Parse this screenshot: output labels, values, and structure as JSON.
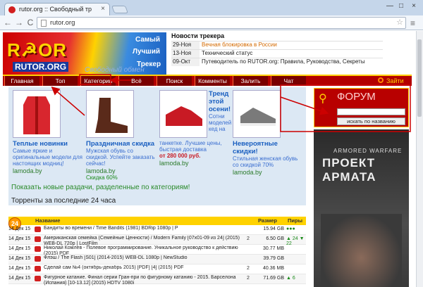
{
  "browser": {
    "tab_title": "rutor.org :: Свободный тр",
    "tab_close": "×",
    "url": "rutor.org",
    "back": "←",
    "forward": "→",
    "reload": "C",
    "star": "☆",
    "menu": "≡",
    "minimize": "—",
    "maximize": "□",
    "close": "×"
  },
  "header": {
    "logo": "R☭OR",
    "logo_domain": "RUTOR.ORG",
    "slogan": [
      "Самый",
      "Лучший",
      "Трекер"
    ],
    "subtitle": "Свободный обмен"
  },
  "news": {
    "title": "Новости трекера",
    "items": [
      {
        "date": "29-Ноя",
        "text": "Вечная блокировка в России",
        "hot": true
      },
      {
        "date": "13-Ноя",
        "text": "Технический статус",
        "hot": false
      },
      {
        "date": "09-Окт",
        "text": "Путеводитель по RUTOR.org: Правила, Руководства, Секреты",
        "hot": false
      }
    ]
  },
  "menu": {
    "items": [
      "Главная",
      "Топ",
      "Категории",
      "Всё",
      "Поиск",
      "Комменты",
      "Залить",
      "Чат"
    ],
    "login": "Зайти"
  },
  "ads": [
    {
      "title": "Теплые новинки",
      "desc": "Самые яркие и оригинальные модели для настоящих модниц!",
      "site": "lamoda.by",
      "price": ""
    },
    {
      "title": "Праздничная скидка",
      "desc": "Мужская обувь со скидкой. Успейте заказать сейчас!",
      "site": "lamoda.by",
      "price": "Скидка 60%"
    },
    {
      "title": "",
      "desc": "танкетке. Лучшие цены, быстрая доставка",
      "site": "lamoda.by",
      "price": "от 280 000 руб.",
      "side_title": "Тренд этой осени!",
      "side_desc": "Сотни моделей кед на"
    },
    {
      "title": "Невероятные скидки!",
      "desc": "Стильная женская обувь со скидкой 70%",
      "site": "lamoda.by",
      "price": ""
    }
  ],
  "categories_link": "Показать новые раздачи, разделенные по категориям!",
  "last24": "Торренты за последние 24 часа",
  "forum": {
    "label": "ФОРУМ",
    "button": "искать по названию"
  },
  "banner": {
    "line1": "ARMORED WARFARE",
    "line2": "ПРОЕКТ АРМАТА"
  },
  "table": {
    "badge": "24",
    "columns": [
      "Название",
      "Размер",
      "Пиры"
    ],
    "rows": [
      {
        "date": "14 Дек 15",
        "name": "Бандиты во времени / Time Bandits (1981) BDRip 1080p | P",
        "size": "15.94 GB",
        "peers": "●●●"
      },
      {
        "date": "14 Дек 15",
        "name": "Американская семейка (Семейные Ценности) / Modern Family [07x01-09 из 24] (2015) WEB-DL 720p | LostFilm",
        "size": "6.50 GB",
        "peers": "▲ 24 ▼ 22",
        "link": "2"
      },
      {
        "date": "14 Дек 15",
        "name": "Николай Комлев - Полевое программирование. Уникальное руководство к действию (2015) PDF",
        "size": "30.77 MB",
        "peers": ""
      },
      {
        "date": "14 Дек 15",
        "name": "Флэш / The Flash [S01] (2014-2015) WEB-DL 1080p | NewStudio",
        "size": "39.79 GB",
        "peers": ""
      },
      {
        "date": "14 Дек 15",
        "name": "Сделай сам №4 (октябрь-декабрь 2015) [PDF] [4] (2015) PDF",
        "size": "40.36 MB",
        "peers": "",
        "link": "2"
      },
      {
        "date": "14 Дек 15",
        "name": "Фигурное катание. Финал серии Гран-при по фигурному катанию - 2015. Барселона (Испания) [10-13.12] (2015) HDTV 1080i",
        "size": "71.69 GB",
        "peers": "▲ 6",
        "link": "2"
      }
    ]
  }
}
